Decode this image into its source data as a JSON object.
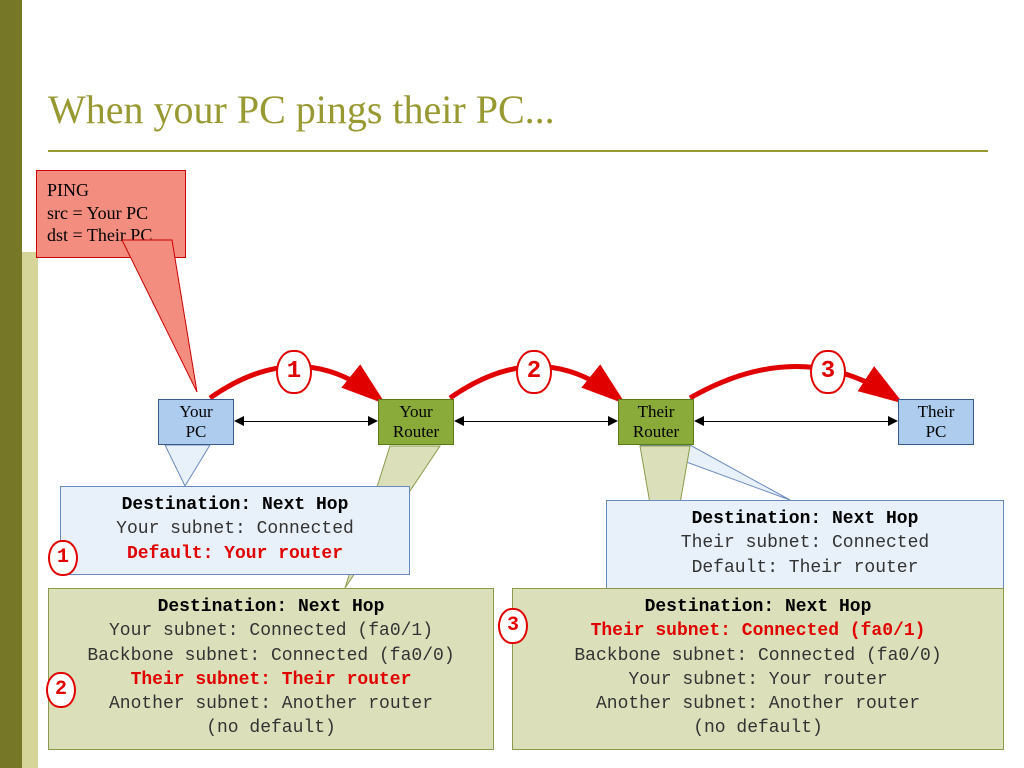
{
  "title": "When your PC pings their PC...",
  "callout": {
    "line1": "PING",
    "line2": "src = Your PC",
    "line3": "dst = Their PC"
  },
  "nodes": {
    "your_pc": "Your\nPC",
    "your_router": "Your\nRouter",
    "their_router": "Their\nRouter",
    "their_pc": "Their\nPC"
  },
  "hops": {
    "h1": "1",
    "h2": "2",
    "h3": "3"
  },
  "steps": {
    "s1": "1",
    "s2": "2",
    "s3": "3"
  },
  "tables": {
    "your_pc": {
      "hdr": "Destination: Next Hop",
      "r1": "Your subnet: Connected",
      "hot": "Default: Your router"
    },
    "their_pc": {
      "hdr": "Destination: Next Hop",
      "r1": "Their subnet: Connected",
      "r2": "Default: Their router"
    },
    "your_router": {
      "hdr": "Destination: Next Hop",
      "r1": "Your subnet: Connected (fa0/1)",
      "r2": "Backbone subnet: Connected (fa0/0)",
      "hot": "Their subnet: Their router",
      "r3": "Another subnet: Another router",
      "r4": "(no default)"
    },
    "their_router": {
      "hdr": "Destination: Next Hop",
      "hot": "Their subnet: Connected (fa0/1)",
      "r1": "Backbone subnet: Connected (fa0/0)",
      "r2": "Your subnet: Your router",
      "r3": "Another subnet: Another router",
      "r4": "(no default)"
    }
  }
}
